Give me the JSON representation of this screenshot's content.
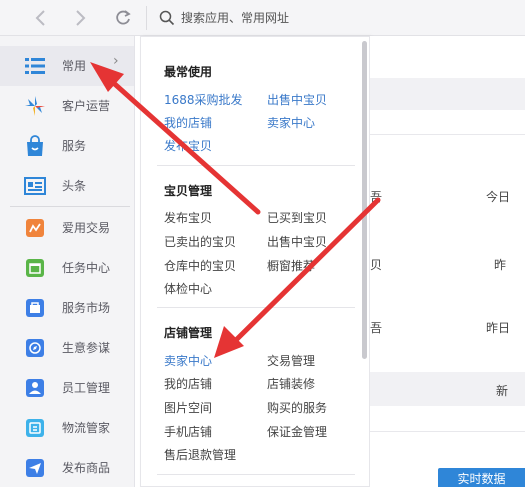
{
  "toolbar": {
    "search_placeholder": "搜索应用、常用网址",
    "back_icon": "chevron-left-icon",
    "forward_icon": "chevron-right-icon",
    "refresh_icon": "refresh-icon",
    "search_icon": "search-icon"
  },
  "sidebar": {
    "items": [
      {
        "label": "常用",
        "icon": "list-icon",
        "color": "#2f86d8"
      },
      {
        "label": "客户运营",
        "icon": "sparkle-icon",
        "color": "#2f86d8"
      },
      {
        "label": "服务",
        "icon": "shopping-bag-icon",
        "color": "#2f86d8"
      },
      {
        "label": "头条",
        "icon": "news-card-icon",
        "color": "#2f86d8"
      },
      {
        "label": "爱用交易",
        "icon": "trade-icon",
        "color": "#f0843c"
      },
      {
        "label": "任务中心",
        "icon": "calendar-icon",
        "color": "#5ab548"
      },
      {
        "label": "服务市场",
        "icon": "market-icon",
        "color": "#3d7fe6"
      },
      {
        "label": "生意参谋",
        "icon": "compass-icon",
        "color": "#3d7fe6"
      },
      {
        "label": "员工管理",
        "icon": "person-icon",
        "color": "#3d7fe6"
      },
      {
        "label": "物流管家",
        "icon": "truck-icon",
        "color": "#3db2ea"
      },
      {
        "label": "发布商品",
        "icon": "send-icon",
        "color": "#3d7fe6"
      }
    ]
  },
  "flyout": {
    "sections": [
      {
        "title": "最常使用",
        "links": [
          "1688采购批发",
          "出售中宝贝",
          "我的店铺",
          "卖家中心",
          "发布宝贝"
        ]
      },
      {
        "title": "宝贝管理",
        "links": [
          "发布宝贝",
          "已买到宝贝",
          "已卖出的宝贝",
          "出售中宝贝",
          "仓库中的宝贝",
          "橱窗推荐",
          "体检中心"
        ]
      },
      {
        "title": "店铺管理",
        "links": [
          "卖家中心",
          "交易管理",
          "我的店铺",
          "店铺装修",
          "图片空间",
          "购买的服务",
          "手机店铺",
          "保证金管理",
          "售后退款管理"
        ]
      }
    ]
  },
  "background": {
    "fragments": [
      "吾",
      "今日",
      "贝",
      "昨",
      "吾",
      "昨日",
      "新"
    ],
    "realtime_button": "实时数据"
  },
  "colors": {
    "link_blue": "#3a79c9",
    "arrow_red": "#e53434",
    "accent_blue": "#2f86d8"
  }
}
